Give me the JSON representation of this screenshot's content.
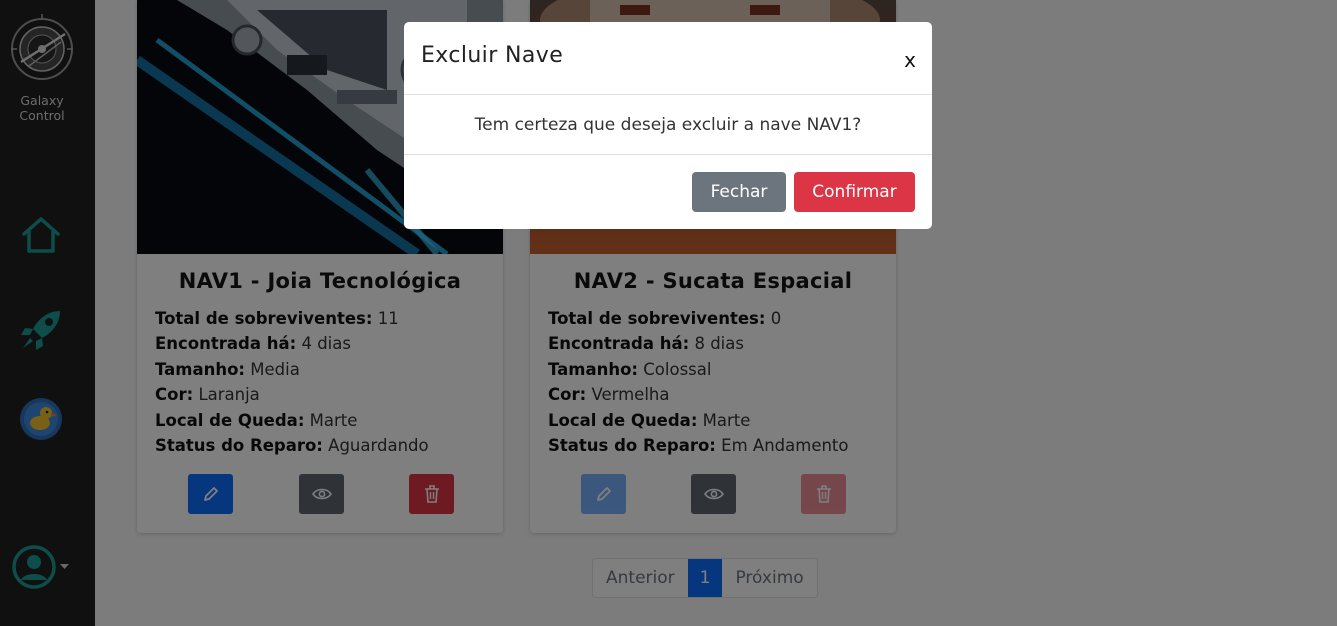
{
  "app": {
    "brand_name": "Galaxy Control"
  },
  "sidebar": {
    "items": [
      {
        "icon": "home-icon"
      },
      {
        "icon": "rocket-icon"
      },
      {
        "icon": "duck-badge-icon"
      }
    ],
    "user_menu_icon": "user-circle-icon"
  },
  "ships": [
    {
      "title": "NAV1 - Joia Tecnológica",
      "details": [
        {
          "label": "Total de sobreviventes:",
          "value": "11"
        },
        {
          "label": "Encontrada há:",
          "value": "4 dias"
        },
        {
          "label": "Tamanho:",
          "value": "Media"
        },
        {
          "label": "Cor:",
          "value": "Laranja"
        },
        {
          "label": "Local de Queda:",
          "value": "Marte"
        },
        {
          "label": "Status do Reparo:",
          "value": "Aguardando"
        }
      ]
    },
    {
      "title": "NAV2 - Sucata Espacial",
      "details": [
        {
          "label": "Total de sobreviventes:",
          "value": "0"
        },
        {
          "label": "Encontrada há:",
          "value": "8 dias"
        },
        {
          "label": "Tamanho:",
          "value": "Colossal"
        },
        {
          "label": "Cor:",
          "value": "Vermelha"
        },
        {
          "label": "Local de Queda:",
          "value": "Marte"
        },
        {
          "label": "Status do Reparo:",
          "value": "Em Andamento"
        }
      ]
    }
  ],
  "pagination": {
    "previous": "Anterior",
    "current": "1",
    "next": "Próximo"
  },
  "modal": {
    "title": "Excluir Nave",
    "close": "x",
    "message": "Tem certeza que deseja excluir a nave NAV1?",
    "cancel_label": "Fechar",
    "confirm_label": "Confirmar"
  },
  "colors": {
    "sidebar_bg": "#212121",
    "accent_teal": "#1a9c94",
    "primary": "#0d6efd",
    "danger": "#dc3545",
    "secondary": "#6c757d"
  }
}
